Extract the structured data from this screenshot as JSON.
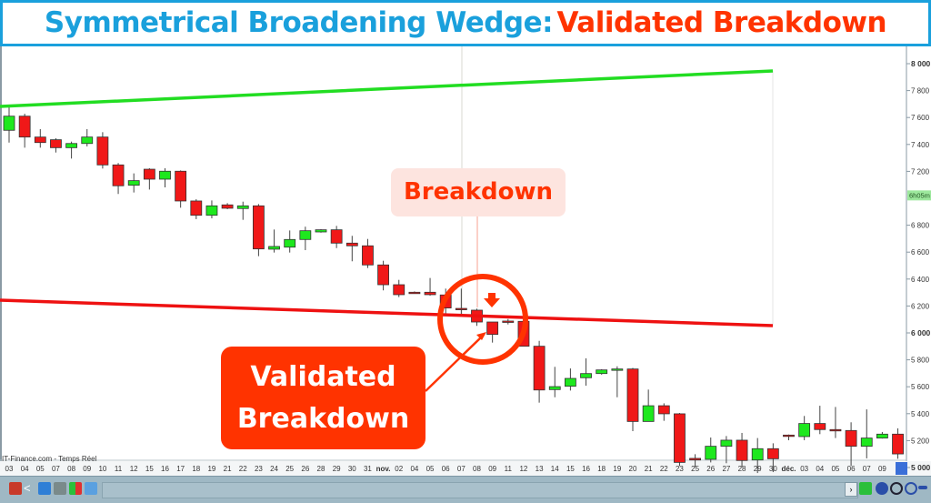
{
  "header": {
    "title_part1": "Symmetrical Broadening Wedge:",
    "title_part2": "Validated Breakdown"
  },
  "source_label": "IT-Finance.com - Temps Réel",
  "timer_badge": "6h05m",
  "annotations": {
    "breakdown": "Breakdown",
    "validated_line1": "Validated",
    "validated_line2": "Breakdown"
  },
  "colors": {
    "title_blue": "#1aa0dc",
    "accent_red": "#ff3300",
    "up_candle": "#1ee81e",
    "down_candle": "#f01818",
    "upper_trendline": "#22dd22",
    "lower_trendline": "#ee1111",
    "toolbar": "#9fb8c4"
  },
  "toolbar": {
    "icons": [
      "strategy-icon",
      "share-icon",
      "chat-icon",
      "indicator-icon",
      "bars-icon",
      "windows-icon"
    ],
    "right_icons": [
      "drawing-icon",
      "zoom-fit-icon",
      "zoom-out-icon",
      "zoom-in-icon",
      "settings-icon"
    ]
  },
  "chart_data": {
    "type": "candlestick",
    "title": "",
    "ylim": [
      4950,
      8080
    ],
    "y_ticks": [
      "8 000",
      "7 800",
      "7 600",
      "7 400",
      "7 200",
      "6 800",
      "6 600",
      "6 400",
      "6 200",
      "6 000",
      "5 800",
      "5 600",
      "5 400",
      "5 200",
      "5 000"
    ],
    "y_tick_values": [
      8000,
      7800,
      7600,
      7400,
      7200,
      6800,
      6600,
      6400,
      6200,
      6000,
      5800,
      5600,
      5400,
      5200,
      5000
    ],
    "x_labels": [
      "03",
      "04",
      "05",
      "07",
      "08",
      "09",
      "10",
      "11",
      "12",
      "15",
      "16",
      "17",
      "18",
      "19",
      "21",
      "22",
      "23",
      "24",
      "25",
      "26",
      "28",
      "29",
      "30",
      "31",
      "nov.",
      "02",
      "04",
      "05",
      "06",
      "07",
      "08",
      "09",
      "11",
      "12",
      "13",
      "14",
      "15",
      "16",
      "18",
      "19",
      "20",
      "21",
      "22",
      "23",
      "25",
      "26",
      "27",
      "28",
      "29",
      "30",
      "déc.",
      "03",
      "04",
      "05",
      "06",
      "07",
      "09"
    ],
    "grid": false,
    "candles": [
      [
        7505,
        7685,
        7414,
        7610
      ],
      [
        7610,
        7628,
        7376,
        7455
      ],
      [
        7455,
        7514,
        7376,
        7414
      ],
      [
        7435,
        7446,
        7340,
        7376
      ],
      [
        7376,
        7421,
        7295,
        7407
      ],
      [
        7407,
        7514,
        7385,
        7455
      ],
      [
        7455,
        7491,
        7221,
        7248
      ],
      [
        7248,
        7262,
        7032,
        7093
      ],
      [
        7097,
        7185,
        7043,
        7131
      ],
      [
        7216,
        7223,
        7065,
        7142
      ],
      [
        7142,
        7223,
        7081,
        7201
      ],
      [
        7201,
        7207,
        6930,
        6980
      ],
      [
        6980,
        6993,
        6845,
        6874
      ],
      [
        6874,
        6984,
        6851,
        6944
      ],
      [
        6951,
        6964,
        6919,
        6926
      ],
      [
        6924,
        6975,
        6840,
        6944
      ],
      [
        6944,
        6957,
        6570,
        6624
      ],
      [
        6622,
        6768,
        6597,
        6642
      ],
      [
        6637,
        6761,
        6597,
        6694
      ],
      [
        6694,
        6789,
        6615,
        6759
      ],
      [
        6750,
        6770,
        6745,
        6766
      ],
      [
        6766,
        6795,
        6630,
        6667
      ],
      [
        6667,
        6721,
        6532,
        6647
      ],
      [
        6647,
        6698,
        6482,
        6505
      ],
      [
        6505,
        6536,
        6316,
        6358
      ],
      [
        6358,
        6394,
        6266,
        6284
      ],
      [
        6302,
        6308,
        6292,
        6300
      ],
      [
        6302,
        6408,
        6277,
        6284
      ],
      [
        6282,
        6329,
        6142,
        6185
      ],
      [
        6182,
        6329,
        6130,
        6174
      ],
      [
        6169,
        6180,
        6052,
        6081
      ],
      [
        6081,
        6081,
        5928,
        5989
      ],
      [
        6088,
        6103,
        6063,
        6084
      ],
      [
        6086,
        6135,
        5901,
        5901
      ],
      [
        5901,
        5941,
        5482,
        5576
      ],
      [
        5579,
        5748,
        5522,
        5601
      ],
      [
        5604,
        5736,
        5572,
        5662
      ],
      [
        5667,
        5811,
        5608,
        5698
      ],
      [
        5698,
        5730,
        5690,
        5725
      ],
      [
        5728,
        5752,
        5522,
        5732
      ],
      [
        5732,
        5740,
        5270,
        5342
      ],
      [
        5342,
        5579,
        5342,
        5459
      ],
      [
        5459,
        5477,
        5347,
        5399
      ],
      [
        5399,
        5405,
        5011,
        5038
      ],
      [
        5068,
        5099,
        5005,
        5056
      ],
      [
        5061,
        5223,
        5038,
        5158
      ],
      [
        5158,
        5234,
        5032,
        5203
      ],
      [
        5203,
        5257,
        5005,
        5052
      ],
      [
        5056,
        5219,
        4959,
        5140
      ],
      [
        5140,
        5180,
        4966,
        5065
      ],
      [
        5241,
        5245,
        5203,
        5234
      ],
      [
        5230,
        5383,
        5203,
        5327
      ],
      [
        5327,
        5459,
        5248,
        5282
      ],
      [
        5282,
        5450,
        5219,
        5276
      ],
      [
        5275,
        5336,
        5011,
        5158
      ],
      [
        5158,
        5432,
        5068,
        5219
      ],
      [
        5219,
        5264,
        5215,
        5248
      ],
      [
        5248,
        5291,
        5065,
        5101
      ]
    ],
    "candle_fields": [
      "open",
      "high",
      "low",
      "close"
    ],
    "trendlines": [
      {
        "role": "upper",
        "start_price": 7682,
        "end_price": 7946,
        "end_label": "30"
      },
      {
        "role": "lower",
        "start_price": 6243,
        "end_price": 6054,
        "end_label": "30"
      }
    ]
  }
}
